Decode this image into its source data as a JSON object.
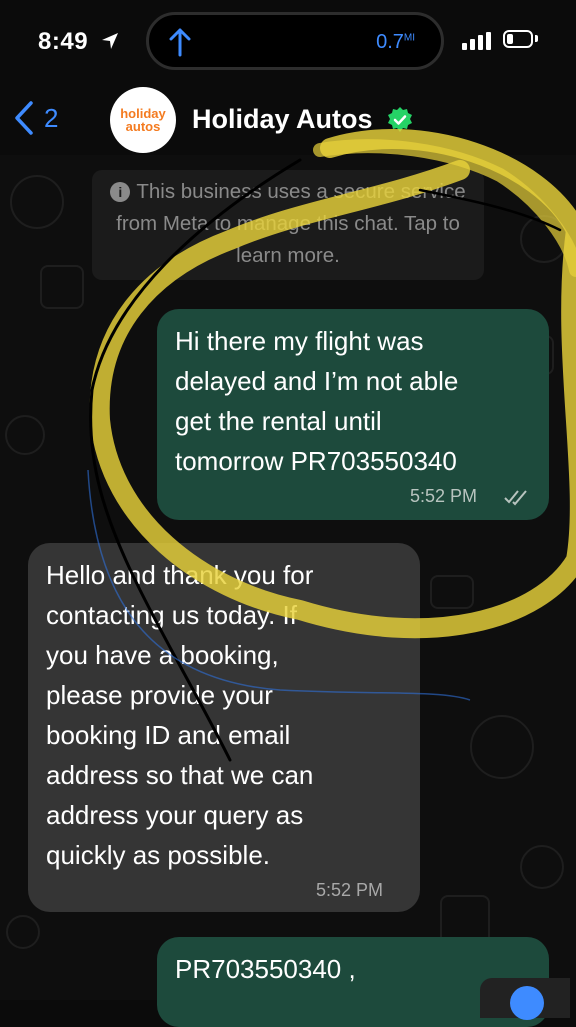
{
  "status_bar": {
    "time": "8:49",
    "network_speed": "0.7",
    "network_unit": "MI"
  },
  "header": {
    "back_count": "2",
    "avatar_line1": "holiday",
    "avatar_line2": "autos",
    "contact_name": "Holiday Autos",
    "verified": true
  },
  "system_notice": {
    "text": "This business uses a secure service from Meta to manage this chat. Tap to learn more."
  },
  "messages": [
    {
      "direction": "outgoing",
      "text": "Hi there my flight was\ndelayed and I’m not able\nget the rental until\ntomorrow PR703550340",
      "time": "5:52 PM",
      "status": "delivered"
    },
    {
      "direction": "incoming",
      "text": "Hello and thank you for\ncontacting us today. If\nyou have a booking,\nplease provide your\nbooking ID and email\naddress so that we can\naddress your query as\nquickly as possible.",
      "time": "5:52 PM"
    },
    {
      "direction": "outgoing",
      "text": "PR703550340 ,"
    }
  ],
  "colors": {
    "accent": "#3e8bff",
    "outgoing_bubble": "#1d4a3c",
    "incoming_bubble": "#353535",
    "highlight": "#e8d23a",
    "verified": "#25d366"
  }
}
